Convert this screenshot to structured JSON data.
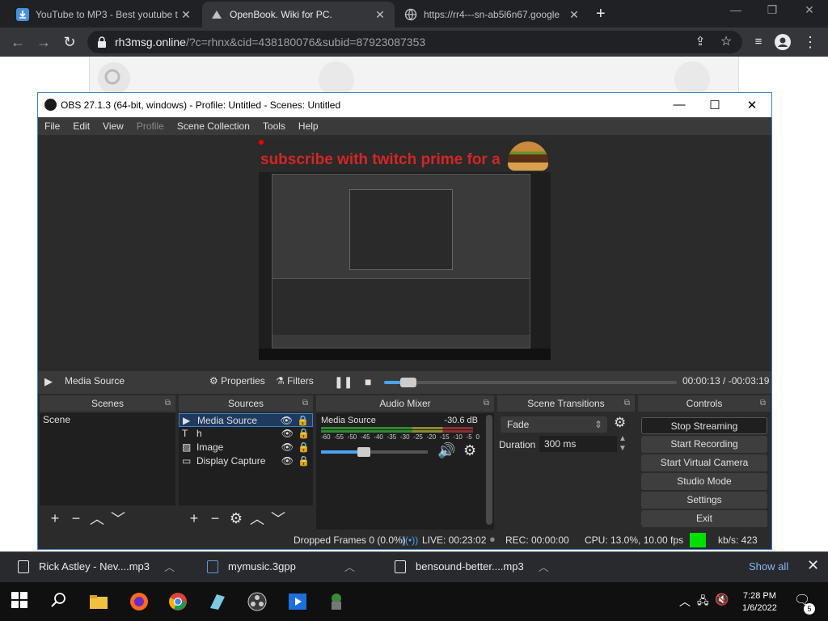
{
  "browser": {
    "tabs": [
      {
        "label": "YouTube to MP3 - Best youtube t"
      },
      {
        "label": "OpenBook. Wiki for PC."
      },
      {
        "label": "https://rr4---sn-ab5l6n67.google"
      }
    ],
    "url_host": "rh3msg.online",
    "url_rest": "/?c=rhnx&cid=438180076&subid=87923087353"
  },
  "obs": {
    "title": "OBS 27.1.3 (64-bit, windows) - Profile: Untitled - Scenes: Untitled",
    "menu": [
      "File",
      "Edit",
      "View",
      "Profile",
      "Scene Collection",
      "Tools",
      "Help"
    ],
    "preview_text": "subscribe with twitch prime for a",
    "controlbar": {
      "source_name": "Media Source",
      "properties": "Properties",
      "filters": "Filters",
      "time": "00:00:13 / -00:03:19",
      "seek_progress": 0.06
    },
    "docks": {
      "scenes": {
        "title": "Scenes",
        "items": [
          "Scene"
        ]
      },
      "sources": {
        "title": "Sources",
        "items": [
          "Media Source",
          "h",
          "Image",
          "Display Capture"
        ]
      },
      "mixer": {
        "title": "Audio Mixer",
        "channel": "Media Source",
        "db": "-30.6 dB",
        "ticks": [
          "-60",
          "-55",
          "-50",
          "-45",
          "-40",
          "-35",
          "-30",
          "-25",
          "-20",
          "-15",
          "-10",
          "-5",
          "0"
        ]
      },
      "transitions": {
        "title": "Scene Transitions",
        "selected": "Fade",
        "duration_label": "Duration",
        "duration": "300 ms"
      },
      "controls": {
        "title": "Controls",
        "buttons": [
          "Stop Streaming",
          "Start Recording",
          "Start Virtual Camera",
          "Studio Mode",
          "Settings",
          "Exit"
        ]
      }
    },
    "status": {
      "dropped": "Dropped Frames 0 (0.0%)",
      "live": "LIVE: 00:23:02",
      "rec": "REC: 00:00:00",
      "cpu": "CPU: 13.0%, 10.00 fps",
      "kbs": "kb/s: 423"
    }
  },
  "downloads": {
    "items": [
      "Rick Astley - Nev....mp3",
      "mymusic.3gpp",
      "bensound-better....mp3"
    ],
    "show_all": "Show all"
  },
  "taskbar": {
    "time": "7:28 PM",
    "date": "1/6/2022",
    "notif_count": "5"
  },
  "colors": {
    "obs_bg": "#2b2b2b",
    "accent": "#3b82c4",
    "stream_green": "#00e000",
    "chrome_dark": "#202124"
  }
}
